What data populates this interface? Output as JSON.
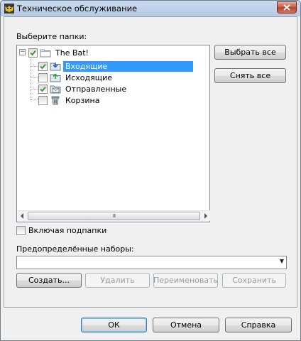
{
  "window": {
    "title": "Техническое обслуживание"
  },
  "folders": {
    "label": "Выберите папки:",
    "tree": {
      "root": {
        "label": "The Bat!",
        "checked": true,
        "expanded": true
      },
      "children": [
        {
          "label": "Входящие",
          "checked": true,
          "selected": true,
          "icon": "inbox-folder-icon"
        },
        {
          "label": "Исходящие",
          "checked": false,
          "selected": false,
          "icon": "outbox-folder-icon"
        },
        {
          "label": "Отправленные",
          "checked": true,
          "selected": false,
          "icon": "sent-folder-icon"
        },
        {
          "label": "Корзина",
          "checked": false,
          "selected": false,
          "icon": "trash-icon"
        }
      ]
    },
    "scroll_thumb_glyph": "III"
  },
  "side_buttons": {
    "select_all": "Выбрать все",
    "deselect_all": "Снять все"
  },
  "include_subfolders": {
    "label": "Включая подпапки",
    "checked": false
  },
  "presets": {
    "label": "Предопределённые наборы:",
    "selected_value": "",
    "dropdown_glyph": "▼",
    "create": "Создать...",
    "delete": "Удалить",
    "rename": "Переименовать",
    "save": "Сохранить"
  },
  "dialog_buttons": {
    "ok": "ОК",
    "cancel": "Отмена",
    "help": "Справка"
  },
  "colors": {
    "selection": "#3399ff",
    "check": "#3a9a3a",
    "close_button": "#c75f48"
  }
}
